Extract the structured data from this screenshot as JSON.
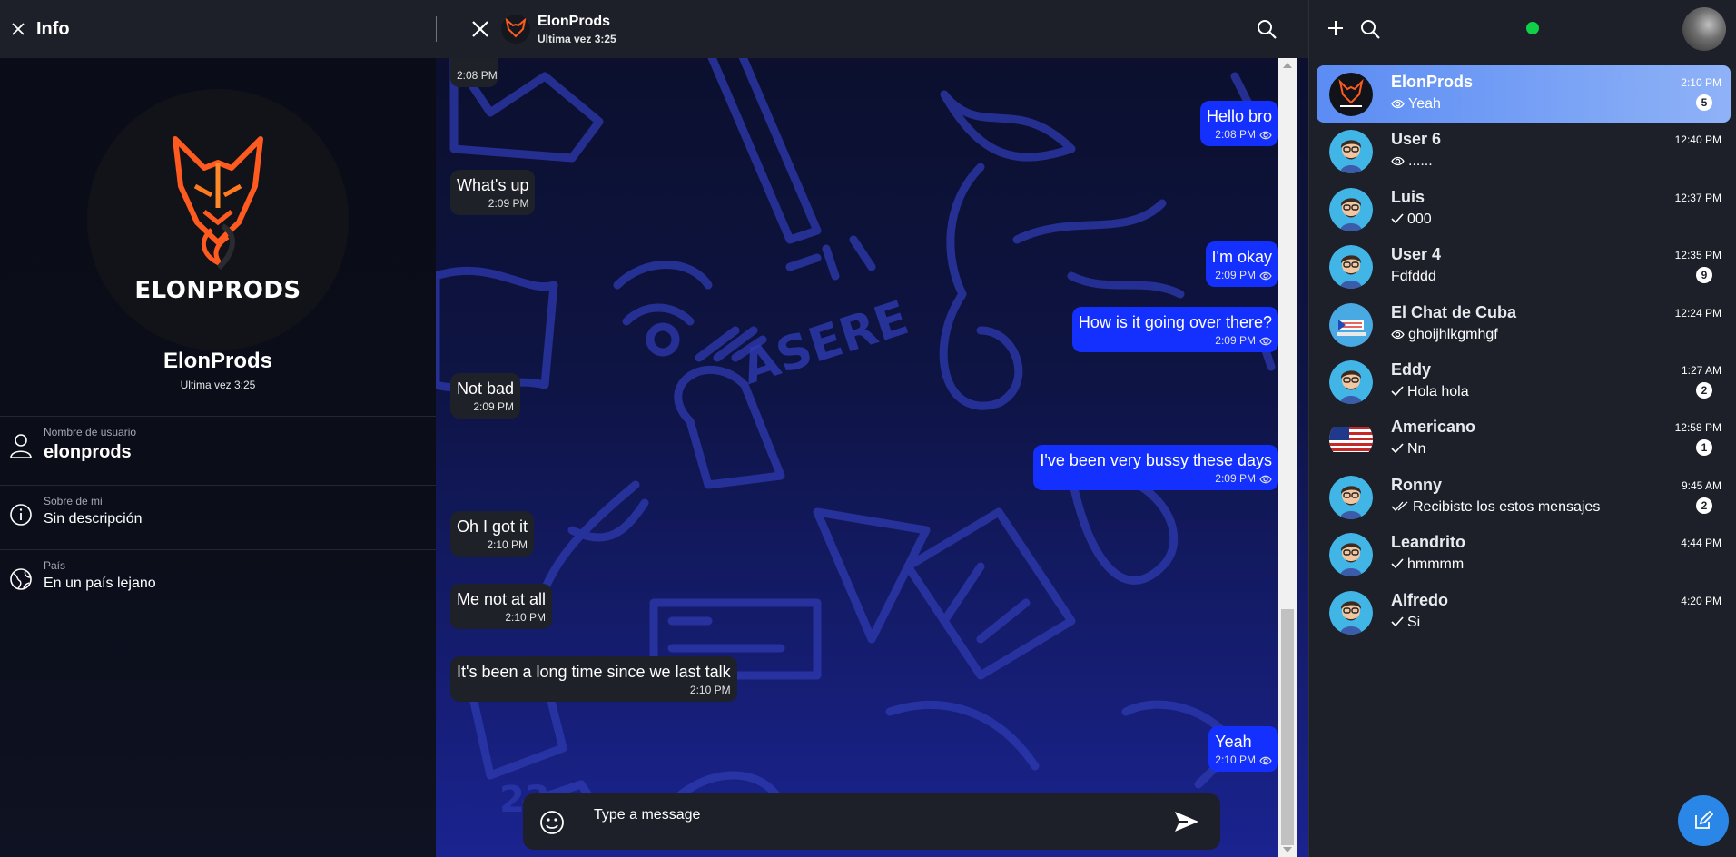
{
  "info": {
    "title": "Info",
    "avatar_brand": "ELONPRODS",
    "name": "ElonProds",
    "last_seen": "Ultima vez 3:25",
    "rows": [
      {
        "icon": "user-icon",
        "label": "Nombre de usuario",
        "value": "elonprods"
      },
      {
        "icon": "info-icon",
        "label": "Sobre de mi",
        "value": "Sin descripción"
      },
      {
        "icon": "globe-icon",
        "label": "País",
        "value": "En un país lejano"
      }
    ]
  },
  "chat": {
    "name": "ElonProds",
    "last_seen": "Ultima vez 3:25",
    "composer_placeholder": "Type a message",
    "messages": [
      {
        "dir": "in",
        "text": "",
        "time": "2:08 PM"
      },
      {
        "dir": "out",
        "text": "Hello bro",
        "time": "2:08 PM"
      },
      {
        "dir": "in",
        "text": "What's up",
        "time": "2:09 PM"
      },
      {
        "dir": "out",
        "text": "I'm okay",
        "time": "2:09 PM"
      },
      {
        "dir": "out",
        "text": "How is it going over there?",
        "time": "2:09 PM"
      },
      {
        "dir": "in",
        "text": "Not bad",
        "time": "2:09 PM"
      },
      {
        "dir": "out",
        "text": "I've been very bussy these days",
        "time": "2:09 PM"
      },
      {
        "dir": "in",
        "text": "Oh I got it",
        "time": "2:10 PM"
      },
      {
        "dir": "in",
        "text": "Me not at all",
        "time": "2:10 PM"
      },
      {
        "dir": "in",
        "text": "It's been a long time since we last talk",
        "time": "2:10 PM"
      },
      {
        "dir": "out",
        "text": "Yeah",
        "time": "2:10 PM"
      }
    ]
  },
  "chat_list": {
    "items": [
      {
        "name": "ElonProds",
        "preview": "Yeah",
        "status": "seen",
        "time": "2:10 PM",
        "badge": "5",
        "avatar": "elonprods-logo"
      },
      {
        "name": "User 6",
        "preview": "......",
        "status": "seen",
        "time": "12:40 PM",
        "badge": "",
        "avatar": "default-avatar"
      },
      {
        "name": "Luis",
        "preview": "000",
        "status": "sent",
        "time": "12:37 PM",
        "badge": "",
        "avatar": "default-avatar"
      },
      {
        "name": "User 4",
        "preview": "Fdfddd",
        "status": "none",
        "time": "12:35 PM",
        "badge": "9",
        "avatar": "default-avatar"
      },
      {
        "name": "El Chat de Cuba",
        "preview": "ghoijhlkgmhgf",
        "status": "seen",
        "time": "12:24 PM",
        "badge": "",
        "avatar": "group-avatar"
      },
      {
        "name": "Eddy",
        "preview": "Hola hola",
        "status": "sent",
        "time": "1:27 AM",
        "badge": "2",
        "avatar": "default-avatar"
      },
      {
        "name": "Americano",
        "preview": "Nn",
        "status": "sent",
        "time": "12:58 PM",
        "badge": "1",
        "avatar": "us-flag"
      },
      {
        "name": "Ronny",
        "preview": "Recibiste los estos mensajes",
        "status": "delivered",
        "time": "9:45 AM",
        "badge": "2",
        "avatar": "default-avatar"
      },
      {
        "name": "Leandrito",
        "preview": "hmmmm",
        "status": "sent",
        "time": "4:44 PM",
        "badge": "",
        "avatar": "default-avatar"
      },
      {
        "name": "Alfredo",
        "preview": "Si",
        "status": "sent",
        "time": "4:20 PM",
        "badge": "",
        "avatar": "default-avatar"
      }
    ]
  },
  "colors": {
    "outgoing_bubble": "#1430ff",
    "incoming_bubble": "#1f2129",
    "panel": "#1d2029",
    "online": "#10d04a",
    "fab": "#2a87e8",
    "active_item": "#5b8cf4"
  }
}
